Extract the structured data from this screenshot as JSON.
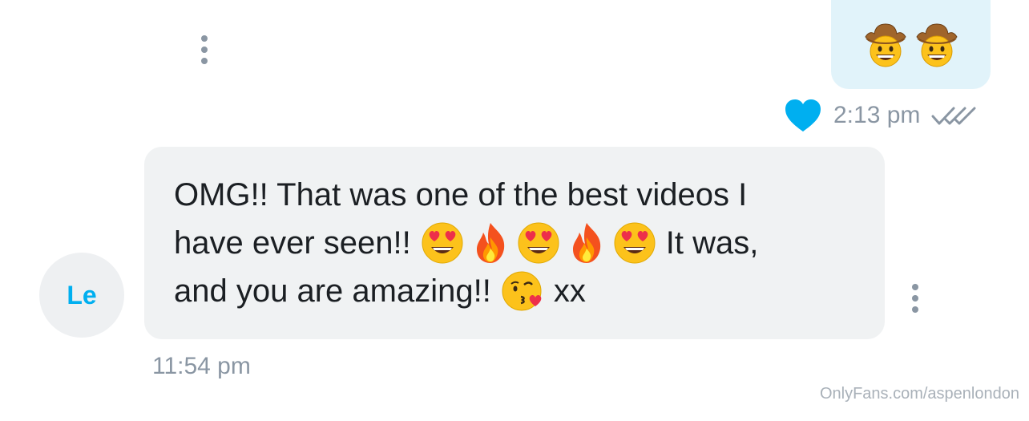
{
  "outgoing_message": {
    "emojis": [
      "cowboy-hat-face-emoji",
      "cowboy-hat-face-emoji"
    ],
    "time": "2:13 pm",
    "liked": true,
    "read": true
  },
  "incoming_message": {
    "avatar_initials": "Le",
    "line1": "OMG!! That was one of the best videos I",
    "line2_start": "have ever seen!!",
    "line2_emojis": [
      "heart-eyes-emoji",
      "fire-emoji",
      "heart-eyes-emoji",
      "fire-emoji",
      "heart-eyes-emoji"
    ],
    "line2_end": "It was,",
    "line3_start": "and you are amazing!!",
    "line3_emoji": "kissing-heart-emoji",
    "line3_end": "xx",
    "time": "11:54 pm"
  },
  "watermark": "OnlyFans.com/aspenlondon",
  "colors": {
    "accent": "#00aff0",
    "outgoing_bubble": "#e1f3fa",
    "incoming_bubble": "#f0f2f3",
    "muted_text": "#8a96a3"
  }
}
